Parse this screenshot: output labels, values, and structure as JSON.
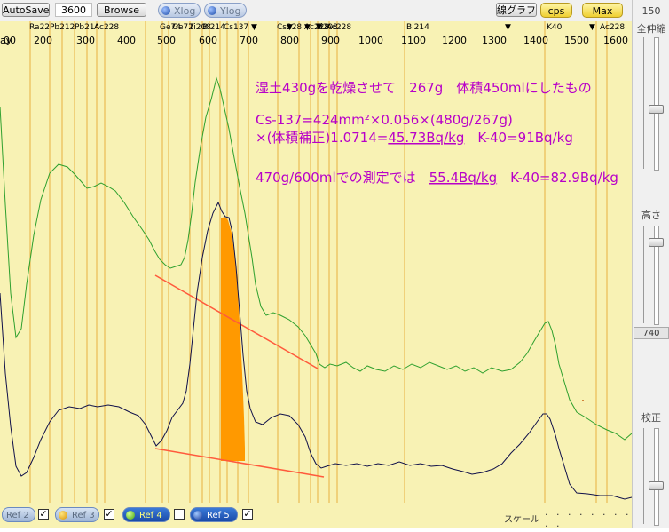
{
  "toolbar": {
    "autosave": "AutoSave",
    "count": "3600",
    "browse": "Browse",
    "xlog": "Xlog",
    "ylog": "Ylog",
    "linear_graph": "線グラフ",
    "cps": "cps",
    "max": "Max"
  },
  "axis": {
    "left_label": "ay",
    "ticks": [
      "00",
      "200",
      "300",
      "400",
      "500",
      "600",
      "700",
      "800",
      "900",
      "1000",
      "1100",
      "1200",
      "1300",
      "1400",
      "1500",
      "1600"
    ]
  },
  "peaks": [
    "Ra22",
    "Pb212",
    "Pb214",
    "Ac228",
    "Ge74",
    "Ge72",
    "Ti208",
    "Bi214",
    "Cs137",
    "Cs228",
    "Ac228",
    "Ti208",
    "Ac228",
    "Bi214",
    "K40",
    "Ac228"
  ],
  "annotations": {
    "line1": "湿土430gを乾燥させて　267g　体積450mlにしたもの",
    "line2": "Cs-137=424mm²×0.056×(480g/267g)",
    "line3_pre": "×(体積補正)1.0714=",
    "line3_val": "45.73Bq/kg",
    "line3_post": "　K-40=91Bq/kg",
    "line4_pre": "470g/600mlでの測定では　",
    "line4_val": "55.4Bq/kg",
    "line4_post": "　K-40=82.9Bq/kg"
  },
  "sidebar": {
    "top_value": "150",
    "label_all": "全伸縮",
    "label_height": "高さ",
    "height_value": "740",
    "label_calib": "校正"
  },
  "bottom": {
    "refs": [
      {
        "label": "Ref 2",
        "checked": true
      },
      {
        "label": "Ref 3",
        "checked": true
      },
      {
        "label": "Ref 4",
        "checked": false
      },
      {
        "label": "Ref 5",
        "checked": true
      }
    ],
    "scale_label": "スケール"
  },
  "colors": {
    "plot_bg": "#f8f2b4",
    "peak_line": "#e8b040",
    "green_trace": "#2ea02e",
    "navy_trace": "#10104a",
    "fill": "#ff9900",
    "baseline": "#ff5a3c",
    "annotation": "#b800c8"
  }
}
